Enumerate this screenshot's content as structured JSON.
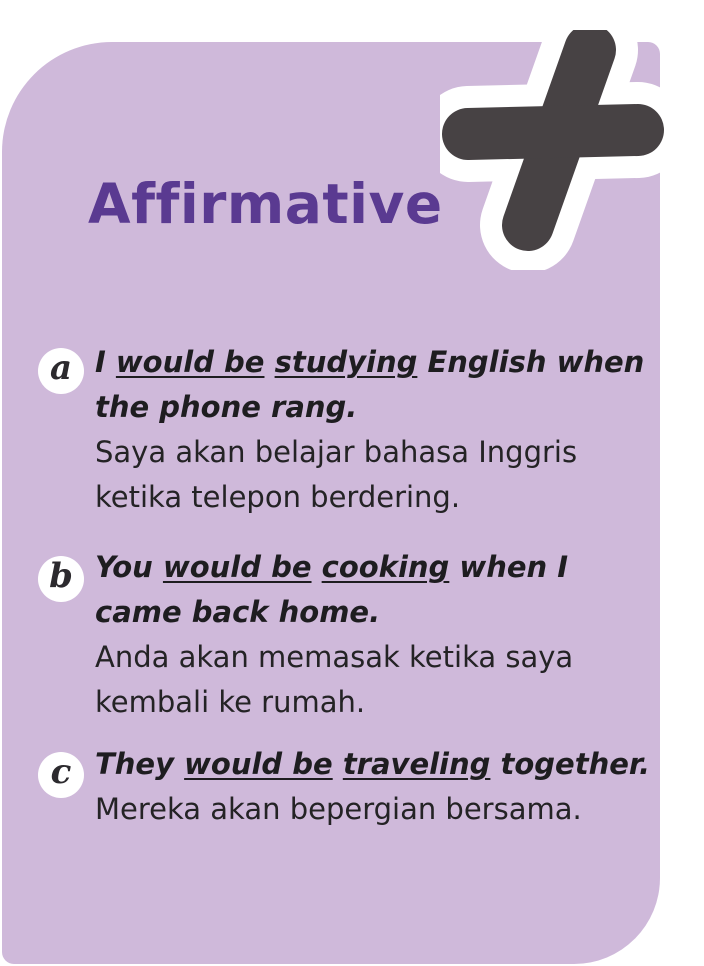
{
  "title": "Affirmative",
  "colors": {
    "card": "#cfb9da",
    "title": "#5a3a91",
    "plus": "#474244",
    "badge": "#ffffff"
  },
  "icon": "plus-icon",
  "items": [
    {
      "letter": "a",
      "english_lines": [
        [
          {
            "text": "I ",
            "u": false
          },
          {
            "text": "would be",
            "u": true
          },
          {
            "text": " ",
            "u": false
          },
          {
            "text": "studying",
            "u": true
          },
          {
            "text": " English when",
            "u": false
          }
        ],
        [
          {
            "text": "the phone rang.",
            "u": false
          }
        ]
      ],
      "indonesian_lines": [
        "Saya akan belajar bahasa Inggris",
        "ketika telepon berdering."
      ]
    },
    {
      "letter": "b",
      "english_lines": [
        [
          {
            "text": "You ",
            "u": false
          },
          {
            "text": "would be",
            "u": true
          },
          {
            "text": " ",
            "u": false
          },
          {
            "text": "cooking",
            "u": true
          },
          {
            "text": " when I",
            "u": false
          }
        ],
        [
          {
            "text": "came back home.",
            "u": false
          }
        ]
      ],
      "indonesian_lines": [
        "Anda akan memasak ketika saya",
        "kembali ke rumah."
      ]
    },
    {
      "letter": "c",
      "english_lines": [
        [
          {
            "text": "They ",
            "u": false
          },
          {
            "text": "would be",
            "u": true
          },
          {
            "text": " ",
            "u": false
          },
          {
            "text": "traveling",
            "u": true
          },
          {
            "text": " together.",
            "u": false
          }
        ]
      ],
      "indonesian_lines": [
        "Mereka akan bepergian bersama."
      ]
    }
  ]
}
